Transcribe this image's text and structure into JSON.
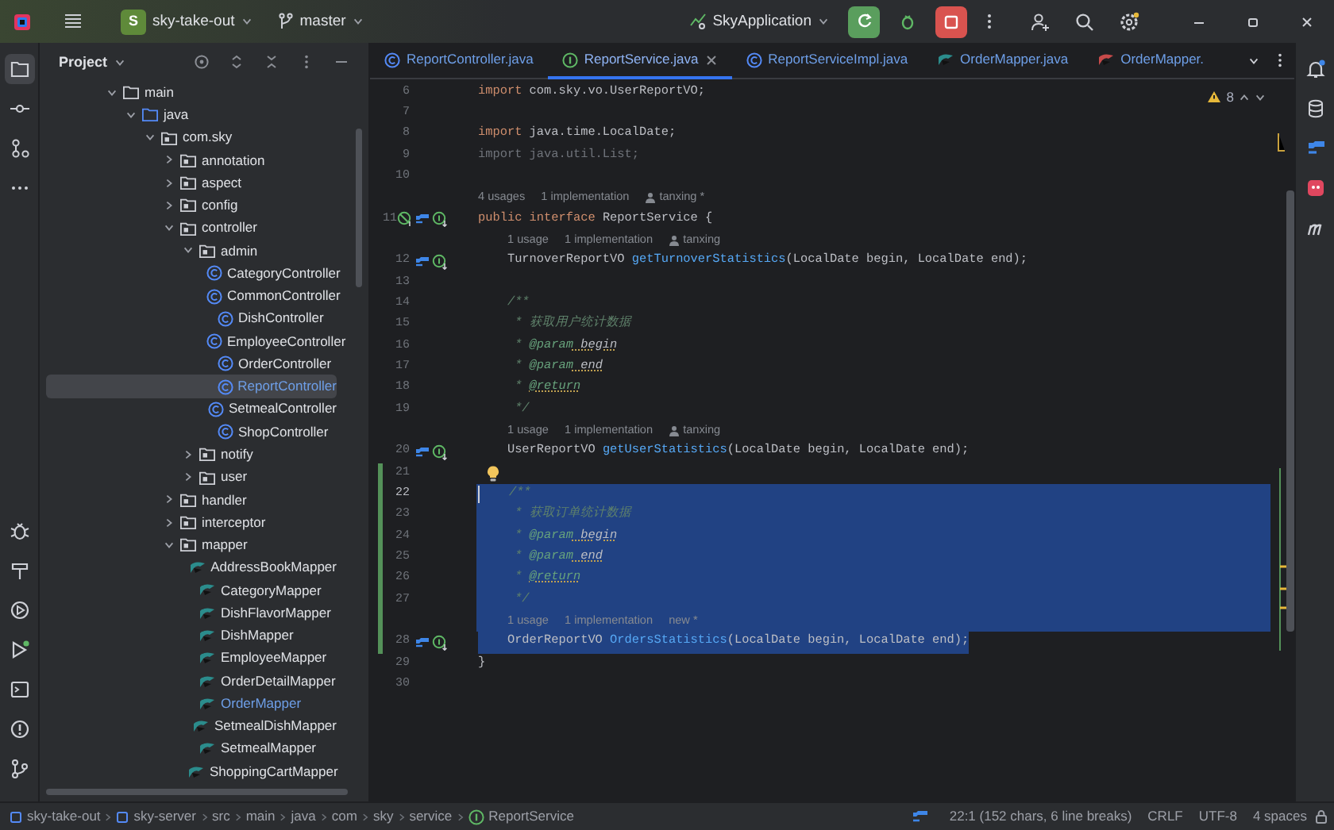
{
  "title_bar": {
    "project_badge": "S",
    "project": "sky-take-out",
    "branch": "master",
    "run_config": "SkyApplication"
  },
  "project_panel": {
    "title": "Project",
    "tree": [
      {
        "label": "main",
        "kind": "folder",
        "expanded": true,
        "selected": false,
        "modified": false,
        "children": [
          {
            "label": "java",
            "kind": "source-folder",
            "expanded": true,
            "selected": false,
            "modified": false,
            "children": [
              {
                "label": "com.sky",
                "kind": "package",
                "expanded": true,
                "selected": false,
                "modified": false,
                "children": [
                  {
                    "label": "annotation",
                    "kind": "package",
                    "expanded": false,
                    "selected": false,
                    "modified": false
                  },
                  {
                    "label": "aspect",
                    "kind": "package",
                    "expanded": false,
                    "selected": false,
                    "modified": false
                  },
                  {
                    "label": "config",
                    "kind": "package",
                    "expanded": false,
                    "selected": false,
                    "modified": false
                  },
                  {
                    "label": "controller",
                    "kind": "package",
                    "expanded": true,
                    "selected": false,
                    "modified": false,
                    "children": [
                      {
                        "label": "admin",
                        "kind": "package",
                        "expanded": true,
                        "selected": false,
                        "modified": false,
                        "children": [
                          {
                            "label": "CategoryController",
                            "kind": "class",
                            "selected": false,
                            "modified": false
                          },
                          {
                            "label": "CommonController",
                            "kind": "class",
                            "selected": false,
                            "modified": false
                          },
                          {
                            "label": "DishController",
                            "kind": "class",
                            "selected": false,
                            "modified": false
                          },
                          {
                            "label": "EmployeeController",
                            "kind": "class",
                            "selected": false,
                            "modified": false
                          },
                          {
                            "label": "OrderController",
                            "kind": "class",
                            "selected": false,
                            "modified": false
                          },
                          {
                            "label": "ReportController",
                            "kind": "class",
                            "selected": true,
                            "modified": true
                          },
                          {
                            "label": "SetmealController",
                            "kind": "class",
                            "selected": false,
                            "modified": false
                          },
                          {
                            "label": "ShopController",
                            "kind": "class",
                            "selected": false,
                            "modified": false
                          }
                        ]
                      },
                      {
                        "label": "notify",
                        "kind": "package",
                        "expanded": false,
                        "selected": false,
                        "modified": false
                      },
                      {
                        "label": "user",
                        "kind": "package",
                        "expanded": false,
                        "selected": false,
                        "modified": false
                      }
                    ]
                  },
                  {
                    "label": "handler",
                    "kind": "package",
                    "expanded": false,
                    "selected": false,
                    "modified": false
                  },
                  {
                    "label": "interceptor",
                    "kind": "package",
                    "expanded": false,
                    "selected": false,
                    "modified": false
                  },
                  {
                    "label": "mapper",
                    "kind": "package",
                    "expanded": true,
                    "selected": false,
                    "modified": false,
                    "children": [
                      {
                        "label": "AddressBookMapper",
                        "kind": "mapper",
                        "selected": false,
                        "modified": false
                      },
                      {
                        "label": "CategoryMapper",
                        "kind": "mapper",
                        "selected": false,
                        "modified": false
                      },
                      {
                        "label": "DishFlavorMapper",
                        "kind": "mapper",
                        "selected": false,
                        "modified": false
                      },
                      {
                        "label": "DishMapper",
                        "kind": "mapper",
                        "selected": false,
                        "modified": false
                      },
                      {
                        "label": "EmployeeMapper",
                        "kind": "mapper",
                        "selected": false,
                        "modified": false
                      },
                      {
                        "label": "OrderDetailMapper",
                        "kind": "mapper",
                        "selected": false,
                        "modified": false
                      },
                      {
                        "label": "OrderMapper",
                        "kind": "mapper",
                        "selected": false,
                        "modified": true
                      },
                      {
                        "label": "SetmealDishMapper",
                        "kind": "mapper",
                        "selected": false,
                        "modified": false
                      },
                      {
                        "label": "SetmealMapper",
                        "kind": "mapper",
                        "selected": false,
                        "modified": false
                      },
                      {
                        "label": "ShoppingCartMapper",
                        "kind": "mapper",
                        "selected": false,
                        "modified": false
                      }
                    ]
                  }
                ]
              }
            ]
          }
        ]
      }
    ]
  },
  "tabs": [
    {
      "label": "ReportController.java",
      "kind": "class",
      "selected": false,
      "modified": true
    },
    {
      "label": "ReportService.java",
      "kind": "interface",
      "selected": true,
      "modified": true
    },
    {
      "label": "ReportServiceImpl.java",
      "kind": "class",
      "selected": false,
      "modified": true
    },
    {
      "label": "OrderMapper.java",
      "kind": "mapper",
      "selected": false,
      "modified": true
    },
    {
      "label": "OrderMapper.",
      "kind": "mapper-xml",
      "selected": false,
      "modified": true
    }
  ],
  "editor": {
    "warnings": "8",
    "lines": [
      {
        "kind": "code",
        "number": "6",
        "current": false,
        "changed": false,
        "selected": false,
        "tokens": [
          {
            "kind": "keyword",
            "text": "import"
          },
          {
            "kind": "plain",
            "text": " com.sky.vo.UserReportVO;"
          }
        ]
      },
      {
        "kind": "code",
        "number": "7",
        "current": false,
        "changed": false,
        "selected": false
      },
      {
        "kind": "code",
        "number": "8",
        "current": false,
        "changed": false,
        "selected": false,
        "tokens": [
          {
            "kind": "keyword",
            "text": "import"
          },
          {
            "kind": "plain",
            "text": " java.time.LocalDate;"
          }
        ]
      },
      {
        "kind": "code",
        "number": "9",
        "current": false,
        "changed": false,
        "selected": false,
        "tokens": [
          {
            "kind": "unused",
            "text": "import java.util.List;"
          }
        ]
      },
      {
        "kind": "code",
        "number": "10",
        "current": false,
        "changed": false,
        "selected": false
      },
      {
        "kind": "hint",
        "changed": false,
        "selected": false,
        "parts": [
          {
            "kind": "usages",
            "text": "4 usages"
          },
          {
            "kind": "implementations",
            "text": "1 implementation"
          },
          {
            "kind": "author",
            "text": "tanxing *"
          }
        ]
      },
      {
        "kind": "code",
        "number": "11",
        "current": false,
        "changed": false,
        "selected": false,
        "gutter": {
          "kind": "interface"
        },
        "tokens": [
          {
            "kind": "keyword",
            "text": "public"
          },
          {
            "kind": "keyword",
            "text": " interface"
          },
          {
            "kind": "plain",
            "text": " ReportService {"
          }
        ]
      },
      {
        "kind": "hint",
        "changed": false,
        "selected": false,
        "parts": [
          {
            "kind": "usages",
            "text": "1 usage"
          },
          {
            "kind": "implementations",
            "text": "1 implementation"
          },
          {
            "kind": "author",
            "text": "tanxing"
          }
        ]
      },
      {
        "kind": "code",
        "number": "12",
        "current": false,
        "changed": false,
        "selected": false,
        "gutter": {
          "kind": "method"
        },
        "tokens": [
          {
            "kind": "plain",
            "text": "    TurnoverReportVO "
          },
          {
            "kind": "function",
            "text": "getTurnoverStatistics"
          },
          {
            "kind": "plain",
            "text": "(LocalDate begin, LocalDate end);"
          }
        ]
      },
      {
        "kind": "code",
        "number": "13",
        "current": false,
        "changed": false,
        "selected": false
      },
      {
        "kind": "code",
        "number": "14",
        "current": false,
        "changed": false,
        "selected": false,
        "tokens": [
          {
            "kind": "doc",
            "text": "    /**"
          }
        ]
      },
      {
        "kind": "code",
        "number": "15",
        "current": false,
        "changed": false,
        "selected": false,
        "tokens": [
          {
            "kind": "doc",
            "text": "     * 获取用户统计数据"
          }
        ]
      },
      {
        "kind": "code",
        "number": "16",
        "current": false,
        "changed": false,
        "selected": false,
        "tokens": [
          {
            "kind": "doc",
            "text": "     * "
          },
          {
            "kind": "tag",
            "text": "@param"
          },
          {
            "kind": "ref",
            "text": " begin"
          }
        ]
      },
      {
        "kind": "code",
        "number": "17",
        "current": false,
        "changed": false,
        "selected": false,
        "tokens": [
          {
            "kind": "doc",
            "text": "     * "
          },
          {
            "kind": "tag",
            "text": "@param"
          },
          {
            "kind": "ref",
            "text": " end"
          }
        ]
      },
      {
        "kind": "code",
        "number": "18",
        "current": false,
        "changed": false,
        "selected": false,
        "tokens": [
          {
            "kind": "doc",
            "text": "     * "
          },
          {
            "kind": "tagref",
            "text": "@return"
          }
        ]
      },
      {
        "kind": "code",
        "number": "19",
        "current": false,
        "changed": false,
        "selected": false,
        "tokens": [
          {
            "kind": "doc",
            "text": "     */"
          }
        ]
      },
      {
        "kind": "hint",
        "changed": false,
        "selected": false,
        "parts": [
          {
            "kind": "usages",
            "text": "1 usage"
          },
          {
            "kind": "implementations",
            "text": "1 implementation"
          },
          {
            "kind": "author",
            "text": "tanxing"
          }
        ]
      },
      {
        "kind": "code",
        "number": "20",
        "current": false,
        "changed": false,
        "selected": false,
        "gutter": {
          "kind": "method"
        },
        "tokens": [
          {
            "kind": "plain",
            "text": "    UserReportVO "
          },
          {
            "kind": "function",
            "text": "getUserStatistics"
          },
          {
            "kind": "plain",
            "text": "(LocalDate begin, LocalDate end);"
          }
        ]
      },
      {
        "kind": "code",
        "number": "21",
        "current": false,
        "changed": true,
        "selected": false,
        "intention": true
      },
      {
        "kind": "code",
        "number": "22",
        "current": true,
        "changed": true,
        "selected": true,
        "partial": false,
        "tokens": [
          {
            "kind": "doc",
            "text": "    /**"
          }
        ]
      },
      {
        "kind": "code",
        "number": "23",
        "current": false,
        "changed": true,
        "selected": true,
        "partial": false,
        "tokens": [
          {
            "kind": "doc",
            "text": "     * 获取订单统计数据"
          }
        ]
      },
      {
        "kind": "code",
        "number": "24",
        "current": false,
        "changed": true,
        "selected": true,
        "partial": false,
        "tokens": [
          {
            "kind": "doc",
            "text": "     * "
          },
          {
            "kind": "tag",
            "text": "@param"
          },
          {
            "kind": "ref",
            "text": " begin"
          }
        ]
      },
      {
        "kind": "code",
        "number": "25",
        "current": false,
        "changed": true,
        "selected": true,
        "partial": false,
        "tokens": [
          {
            "kind": "doc",
            "text": "     * "
          },
          {
            "kind": "tag",
            "text": "@param"
          },
          {
            "kind": "ref",
            "text": " end"
          }
        ]
      },
      {
        "kind": "code",
        "number": "26",
        "current": false,
        "changed": true,
        "selected": true,
        "partial": false,
        "tokens": [
          {
            "kind": "doc",
            "text": "     * "
          },
          {
            "kind": "tagref",
            "text": "@return"
          }
        ]
      },
      {
        "kind": "code",
        "number": "27",
        "current": false,
        "changed": true,
        "selected": true,
        "partial": false,
        "tokens": [
          {
            "kind": "doc",
            "text": "     */"
          }
        ]
      },
      {
        "kind": "hint",
        "changed": true,
        "selected": true,
        "partial": false,
        "parts": [
          {
            "kind": "usages",
            "text": "1 usage"
          },
          {
            "kind": "implementations",
            "text": "1 implementation"
          },
          {
            "kind": "status",
            "text": "new *"
          }
        ]
      },
      {
        "kind": "code",
        "number": "28",
        "current": false,
        "changed": true,
        "selected": true,
        "partial": true,
        "gutter": {
          "kind": "method"
        },
        "tokens": [
          {
            "kind": "plain",
            "text": "    OrderReportVO "
          },
          {
            "kind": "function",
            "text": "OrdersStatistics"
          },
          {
            "kind": "plain",
            "text": "(LocalDate begin, LocalDate end);"
          }
        ]
      },
      {
        "kind": "code",
        "number": "29",
        "current": false,
        "changed": false,
        "selected": false,
        "tokens": [
          {
            "kind": "plain",
            "text": "}"
          }
        ]
      },
      {
        "kind": "code",
        "number": "30",
        "current": false,
        "changed": false,
        "selected": false
      }
    ]
  },
  "status_bar": {
    "breadcrumbs": [
      {
        "label": "sky-take-out",
        "kind": "module"
      },
      {
        "label": "sky-server",
        "kind": "module"
      },
      {
        "label": "src",
        "kind": "folder"
      },
      {
        "label": "main",
        "kind": "folder"
      },
      {
        "label": "java",
        "kind": "folder"
      },
      {
        "label": "com",
        "kind": "folder"
      },
      {
        "label": "sky",
        "kind": "folder"
      },
      {
        "label": "service",
        "kind": "folder"
      },
      {
        "label": "ReportService",
        "kind": "interface"
      }
    ],
    "position": "22:1 (152 chars, 6 line breaks)",
    "line_separator": "CRLF",
    "encoding": "UTF-8",
    "indent": "4 spaces"
  }
}
